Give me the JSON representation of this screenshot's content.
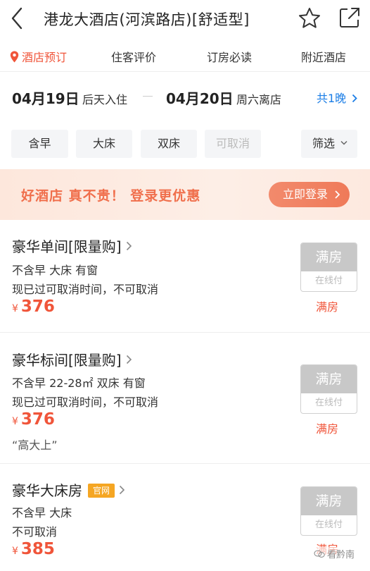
{
  "header": {
    "title": "港龙大酒店(河滨路店)[舒适型]"
  },
  "tabs": [
    {
      "label": "酒店预订",
      "active": true
    },
    {
      "label": "住客评价",
      "active": false
    },
    {
      "label": "订房必读",
      "active": false
    },
    {
      "label": "附近酒店",
      "active": false
    }
  ],
  "dates": {
    "checkin_date": "04月19日",
    "checkin_note": "后天入住",
    "checkout_date": "04月20日",
    "checkout_note": "周六离店",
    "nights": "共1晚"
  },
  "filters": {
    "chips": [
      {
        "label": "含早",
        "enabled": true
      },
      {
        "label": "大床",
        "enabled": true
      },
      {
        "label": "双床",
        "enabled": true
      },
      {
        "label": "可取消",
        "enabled": false
      }
    ],
    "filter_label": "筛选"
  },
  "promo": {
    "text": "好酒店 真不贵！ 登录更优惠",
    "button": "立即登录"
  },
  "rooms": [
    {
      "name": "豪华单间[限量购]",
      "details": "不含早 大床 有窗",
      "policy": "现已过可取消时间，不可取消",
      "currency": "¥",
      "price": "376",
      "quote": "",
      "status_top": "满房",
      "status_bottom": "在线付",
      "full_label": "满房"
    },
    {
      "name": "豪华标间[限量购]",
      "details": "不含早 22-28㎡ 双床 有窗",
      "policy": "现已过可取消时间，不可取消",
      "currency": "¥",
      "price": "376",
      "quote": "“高大上”",
      "status_top": "满房",
      "status_bottom": "在线付",
      "full_label": "满房"
    },
    {
      "name": "豪华大床房",
      "badge": "官网",
      "details": "不含早 大床",
      "policy": "不可取消",
      "currency": "¥",
      "price": "385",
      "quote": "",
      "status_top": "满房",
      "status_bottom": "在线付",
      "full_label": "满房"
    }
  ],
  "watermark": "看黔南",
  "colors": {
    "accent": "#f0553a",
    "link": "#1a7de6",
    "promo_text": "#f06f4c",
    "badge": "#f5a623",
    "disabled_button": "#c8c8c8"
  }
}
